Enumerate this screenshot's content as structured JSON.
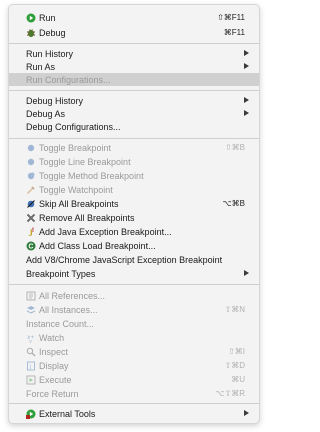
{
  "menu": {
    "items": [
      {
        "label": "Run",
        "shortcut": "⇧⌘F11",
        "icon": "run-icon",
        "enabled": true
      },
      {
        "label": "Debug",
        "shortcut": "⌘F11",
        "icon": "debug-icon",
        "enabled": true
      },
      {
        "label": "Run History",
        "submenu": true,
        "enabled": true
      },
      {
        "label": "Run As",
        "submenu": true,
        "enabled": true
      },
      {
        "label": "Run Configurations...",
        "enabled": false,
        "highlighted": true
      },
      {
        "label": "Debug History",
        "submenu": true,
        "enabled": true
      },
      {
        "label": "Debug As",
        "submenu": true,
        "enabled": true
      },
      {
        "label": "Debug Configurations...",
        "enabled": true
      },
      {
        "label": "Toggle Breakpoint",
        "shortcut": "⇧⌘B",
        "icon": "breakpoint-icon",
        "enabled": false
      },
      {
        "label": "Toggle Line Breakpoint",
        "icon": "line-breakpoint-icon",
        "enabled": false
      },
      {
        "label": "Toggle Method Breakpoint",
        "icon": "method-breakpoint-icon",
        "enabled": false
      },
      {
        "label": "Toggle Watchpoint",
        "icon": "watchpoint-icon",
        "enabled": false
      },
      {
        "label": "Skip All Breakpoints",
        "shortcut": "⌥⌘B",
        "icon": "skip-breakpoints-icon",
        "enabled": true
      },
      {
        "label": "Remove All Breakpoints",
        "icon": "remove-breakpoints-icon",
        "enabled": true
      },
      {
        "label": "Add Java Exception Breakpoint...",
        "icon": "java-exception-icon",
        "enabled": true
      },
      {
        "label": "Add Class Load Breakpoint...",
        "icon": "class-load-icon",
        "enabled": true
      },
      {
        "label": "Add V8/Chrome JavaScript Exception Breakpoint",
        "enabled": true
      },
      {
        "label": "Breakpoint Types",
        "submenu": true,
        "enabled": true
      },
      {
        "label": "All References...",
        "icon": "references-icon",
        "enabled": false
      },
      {
        "label": "All Instances...",
        "shortcut": "⇧⌘N",
        "icon": "instances-icon",
        "enabled": false
      },
      {
        "label": "Instance Count...",
        "enabled": false
      },
      {
        "label": "Watch",
        "icon": "watch-icon",
        "enabled": false
      },
      {
        "label": "Inspect",
        "shortcut": "⇧⌘I",
        "icon": "inspect-icon",
        "enabled": false
      },
      {
        "label": "Display",
        "shortcut": "⇧⌘D",
        "icon": "display-icon",
        "enabled": false
      },
      {
        "label": "Execute",
        "shortcut": "⌘U",
        "icon": "execute-icon",
        "enabled": false
      },
      {
        "label": "Force Return",
        "shortcut": "⌥⇧⌘R",
        "enabled": false
      },
      {
        "label": "External Tools",
        "submenu": true,
        "icon": "external-tools-icon",
        "enabled": true
      }
    ]
  },
  "colors": {
    "highlight": "#d0d0d0",
    "disabled_text": "#9a9a9a",
    "menu_bg": "#f3f3f3"
  }
}
